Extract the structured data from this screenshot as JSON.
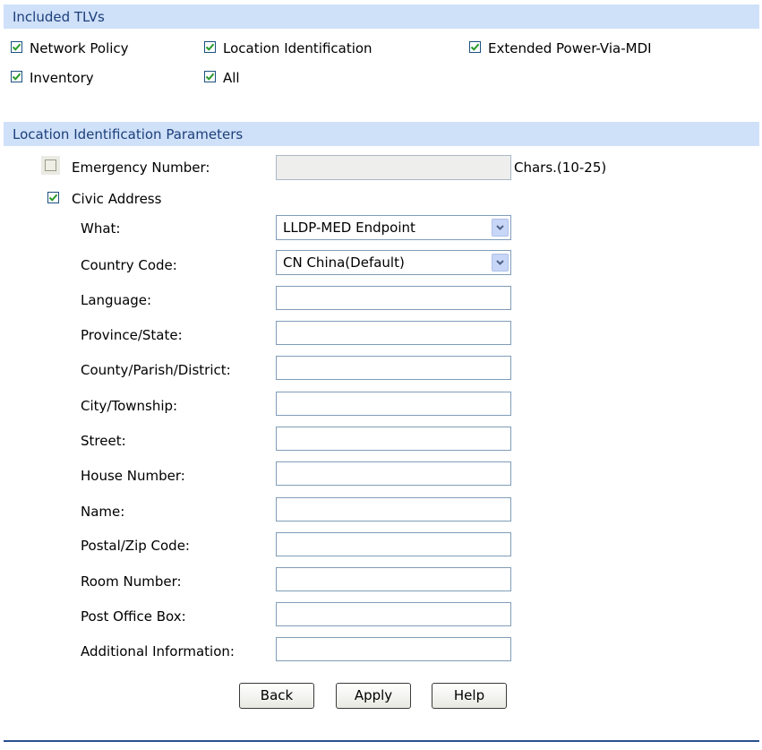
{
  "included_tlvs": {
    "header": "Included TLVs",
    "items": [
      {
        "label": "Network Policy",
        "checked": true
      },
      {
        "label": "Location Identification",
        "checked": true
      },
      {
        "label": "Extended Power-Via-MDI",
        "checked": true
      },
      {
        "label": "Inventory",
        "checked": true
      },
      {
        "label": "All",
        "checked": true
      }
    ]
  },
  "location": {
    "header": "Location Identification Parameters",
    "emergency_number": {
      "label": "Emergency Number:",
      "checked": false,
      "value": "",
      "hint": "Chars.(10-25)"
    },
    "civic_address": {
      "label": "Civic Address",
      "checked": true
    },
    "what": {
      "label": "What:",
      "selected": "LLDP-MED Endpoint"
    },
    "country_code": {
      "label": "Country Code:",
      "selected": "CN China(Default)"
    },
    "fields": [
      {
        "label": "Language:",
        "value": ""
      },
      {
        "label": "Province/State:",
        "value": ""
      },
      {
        "label": "County/Parish/District:",
        "value": ""
      },
      {
        "label": "City/Township:",
        "value": ""
      },
      {
        "label": "Street:",
        "value": ""
      },
      {
        "label": "House Number:",
        "value": ""
      },
      {
        "label": "Name:",
        "value": ""
      },
      {
        "label": "Postal/Zip Code:",
        "value": ""
      },
      {
        "label": "Room Number:",
        "value": ""
      },
      {
        "label": "Post Office Box:",
        "value": ""
      },
      {
        "label": "Additional Information:",
        "value": ""
      }
    ]
  },
  "buttons": {
    "back": "Back",
    "apply": "Apply",
    "help": "Help"
  },
  "colors": {
    "header_bg": "#cfe0f9",
    "header_text": "#1c3f7a",
    "check": "#2a9a2a",
    "rule": "#27508f"
  }
}
